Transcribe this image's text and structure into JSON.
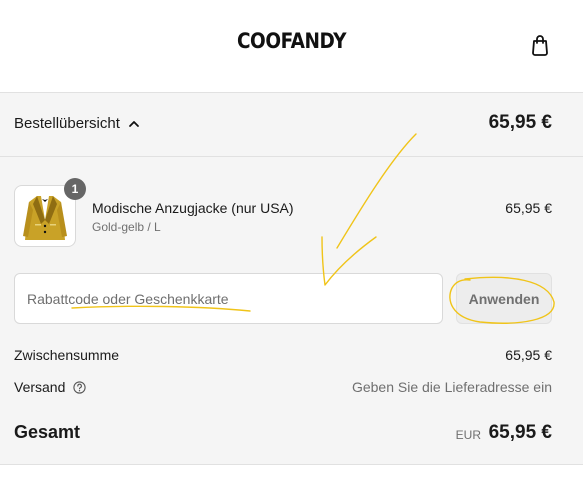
{
  "header": {
    "brand": "COOFANDY",
    "cart_icon": "shopping-bag-icon"
  },
  "summary": {
    "toggle_label": "Bestellübersicht",
    "toggle_icon": "chevron-up-icon",
    "total": "65,95 €"
  },
  "line_item": {
    "quantity": "1",
    "name": "Modische Anzugjacke (nur USA)",
    "variant": "Gold-gelb / L",
    "price": "65,95 €",
    "image_icon": "gold-suit-jacket-thumbnail"
  },
  "discount": {
    "placeholder": "Rabattcode oder Geschenkkarte",
    "apply_label": "Anwenden"
  },
  "totals": {
    "subtotal_label": "Zwischensumme",
    "subtotal_value": "65,95 €",
    "shipping_label": "Versand",
    "shipping_help_icon": "question-circle-icon",
    "shipping_value": "Geben Sie die Lieferadresse ein",
    "total_label": "Gesamt",
    "total_currency": "EUR",
    "total_value": "65,95 €"
  },
  "colors": {
    "panel_bg": "#f5f5f5",
    "annotation": "#f0c419"
  }
}
